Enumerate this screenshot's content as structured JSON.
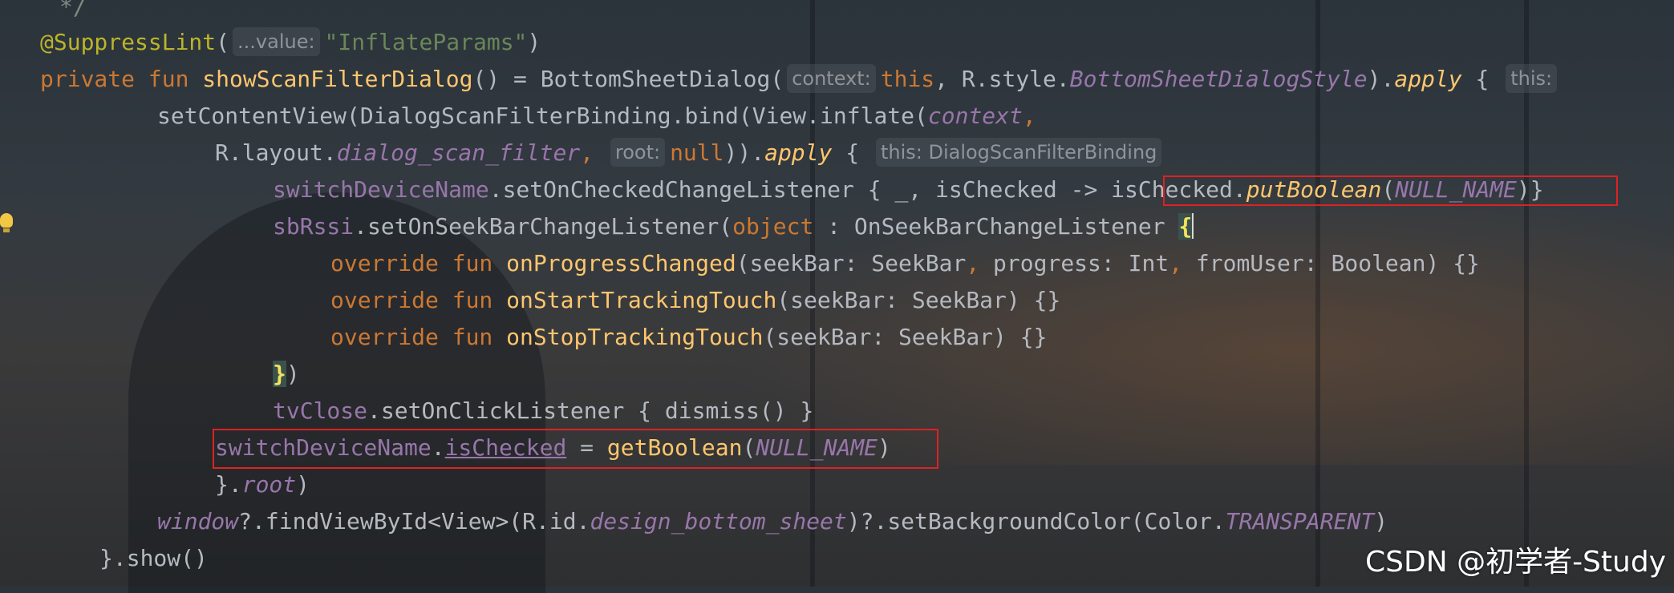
{
  "editor": {
    "lines": [
      [
        {
          "t": "*/",
          "c": "t-comment"
        }
      ],
      [
        {
          "t": "@SuppressLint",
          "c": "t-ann"
        },
        {
          "t": "(",
          "c": "t-plain"
        },
        {
          "hint": "...value:"
        },
        {
          "t": "\"InflateParams\"",
          "c": "t-str"
        },
        {
          "t": ")",
          "c": "t-plain"
        }
      ],
      [
        {
          "t": "private ",
          "c": "t-kw"
        },
        {
          "t": "fun ",
          "c": "t-kw"
        },
        {
          "t": "showScanFilterDialog",
          "c": "t-fn"
        },
        {
          "t": "() = BottomSheetDialog(",
          "c": "t-plain"
        },
        {
          "hint": "context:"
        },
        {
          "t": "this",
          "c": "t-kw"
        },
        {
          "t": ", R.style.",
          "c": "t-plain"
        },
        {
          "t": "BottomSheetDialogStyle",
          "c": "t-ital"
        },
        {
          "t": ").",
          "c": "t-plain"
        },
        {
          "t": "apply",
          "c": "t-ext"
        },
        {
          "t": " { ",
          "c": "t-plain"
        },
        {
          "hint": "this:"
        }
      ],
      [
        {
          "t": "setContentView(DialogScanFilterBinding.bind(View.inflate(",
          "c": "t-plain"
        },
        {
          "t": "context",
          "c": "t-ital"
        },
        {
          "t": ",",
          "c": "t-kw"
        }
      ],
      [
        {
          "t": "R.layout.",
          "c": "t-plain"
        },
        {
          "t": "dialog_scan_filter",
          "c": "t-ital"
        },
        {
          "t": ",",
          "c": "t-kw"
        },
        {
          "t": " ",
          "c": "t-plain"
        },
        {
          "hint": "root:"
        },
        {
          "t": "null",
          "c": "t-kw"
        },
        {
          "t": ")).",
          "c": "t-plain"
        },
        {
          "t": "apply",
          "c": "t-ext"
        },
        {
          "t": " { ",
          "c": "t-plain"
        },
        {
          "hint": "this: DialogScanFilterBinding"
        }
      ],
      [
        {
          "t": "switchDeviceName",
          "c": "t-prop"
        },
        {
          "t": ".setOnCheckedChangeListener { _, isChecked -> ",
          "c": "t-plain"
        },
        {
          "t": "isChecked.",
          "c": "t-plain"
        },
        {
          "t": "putBoolean",
          "c": "t-ext"
        },
        {
          "t": "(",
          "c": "t-plain"
        },
        {
          "t": "NULL_NAME",
          "c": "t-ital"
        },
        {
          "t": ")",
          "c": "t-plain"
        },
        {
          "t": "}",
          "c": "t-plain"
        }
      ],
      [
        {
          "t": "sbRssi",
          "c": "t-prop"
        },
        {
          "t": ".setOnSeekBarChangeListener(",
          "c": "t-plain"
        },
        {
          "t": "object",
          "c": "t-kw"
        },
        {
          "t": " : OnSeekBarChangeListener ",
          "c": "t-plain"
        },
        {
          "t": "{",
          "c": "t-brace-hl"
        },
        {
          "caret": true
        }
      ],
      [
        {
          "t": "override ",
          "c": "t-kw"
        },
        {
          "t": "fun ",
          "c": "t-kw"
        },
        {
          "t": "onProgressChanged",
          "c": "t-fn"
        },
        {
          "t": "(seekBar: SeekBar",
          "c": "t-plain"
        },
        {
          "t": ",",
          "c": "t-kw"
        },
        {
          "t": " progress: Int",
          "c": "t-plain"
        },
        {
          "t": ",",
          "c": "t-kw"
        },
        {
          "t": " fromUser: Boolean) {}",
          "c": "t-plain"
        }
      ],
      [
        {
          "t": "override ",
          "c": "t-kw"
        },
        {
          "t": "fun ",
          "c": "t-kw"
        },
        {
          "t": "onStartTrackingTouch",
          "c": "t-fn"
        },
        {
          "t": "(seekBar: SeekBar) {}",
          "c": "t-plain"
        }
      ],
      [
        {
          "t": "override ",
          "c": "t-kw"
        },
        {
          "t": "fun ",
          "c": "t-kw"
        },
        {
          "t": "onStopTrackingTouch",
          "c": "t-fn"
        },
        {
          "t": "(seekBar: SeekBar) {}",
          "c": "t-plain"
        }
      ],
      [
        {
          "t": "}",
          "c": "t-brace-hl"
        },
        {
          "t": ")",
          "c": "t-plain"
        }
      ],
      [
        {
          "t": "tvClose",
          "c": "t-prop"
        },
        {
          "t": ".setOnClickListener { dismiss() }",
          "c": "t-plain"
        }
      ],
      [
        {
          "t": "switchDeviceName",
          "c": "t-prop"
        },
        {
          "t": ".",
          "c": "t-plain"
        },
        {
          "t": "isChecked",
          "c": "t-prop t-underline"
        },
        {
          "t": " = ",
          "c": "t-plain"
        },
        {
          "t": "getBoolean",
          "c": "t-fn"
        },
        {
          "t": "(",
          "c": "t-plain"
        },
        {
          "t": "NULL_NAME",
          "c": "t-ital"
        },
        {
          "t": ")",
          "c": "t-plain"
        }
      ],
      [
        {
          "t": "}.",
          "c": "t-plain"
        },
        {
          "t": "root",
          "c": "t-ital"
        },
        {
          "t": ")",
          "c": "t-plain"
        }
      ],
      [
        {
          "t": "window",
          "c": "t-ital"
        },
        {
          "t": "?.findViewById<View>(R.id.",
          "c": "t-plain"
        },
        {
          "t": "design_bottom_sheet",
          "c": "t-ital"
        },
        {
          "t": ")?.setBackgroundColor(Color.",
          "c": "t-plain"
        },
        {
          "t": "TRANSPARENT",
          "c": "t-ital"
        },
        {
          "t": ")",
          "c": "t-plain"
        }
      ],
      [
        {
          "t": "}.show()",
          "c": "t-plain"
        }
      ]
    ]
  },
  "watermark": "CSDN @初学者-Study"
}
